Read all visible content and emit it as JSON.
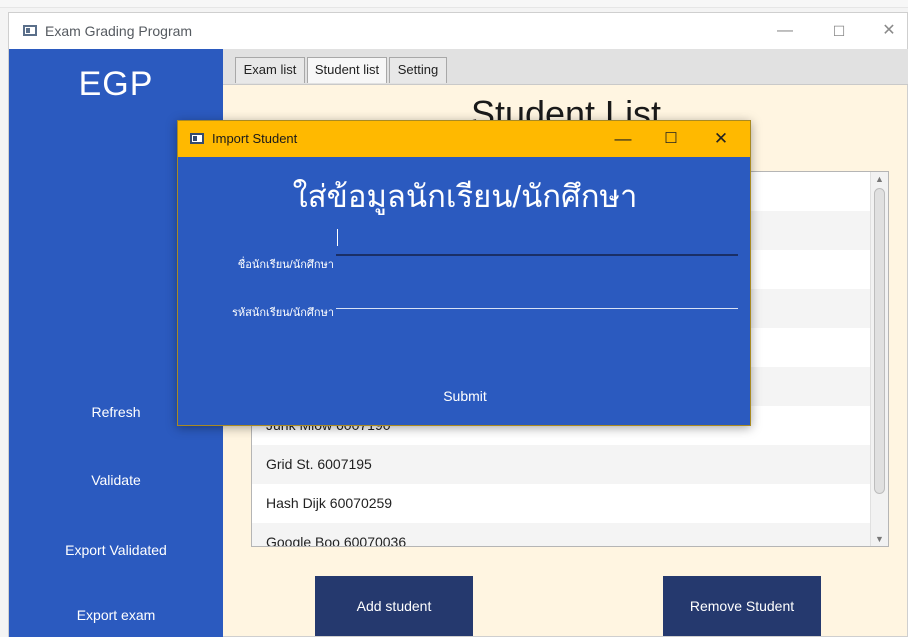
{
  "window": {
    "title": "Exam Grading Program",
    "controls": {
      "minimize": "—",
      "maximize": "☐",
      "close": "✕"
    }
  },
  "sidebar": {
    "brand": "EGP",
    "buttons": [
      "Refresh",
      "Validate",
      "Export Validated",
      "Export exam"
    ]
  },
  "tabs": [
    {
      "label": "Exam list",
      "active": false
    },
    {
      "label": "Student list",
      "active": true
    },
    {
      "label": "Setting",
      "active": false
    }
  ],
  "main": {
    "title": "Student List",
    "students": [
      {
        "text": ""
      },
      {
        "text": ""
      },
      {
        "text": ""
      },
      {
        "text": ""
      },
      {
        "text": ""
      },
      {
        "text": ""
      },
      {
        "text": "Junk Mlow 6007190"
      },
      {
        "text": "Grid St. 6007195"
      },
      {
        "text": "Hash Dijk 60070259"
      },
      {
        "text": "Google Boo 60070036"
      }
    ],
    "add_button": "Add student",
    "remove_button": "Remove Student"
  },
  "dialog": {
    "title": "Import Student",
    "controls": {
      "minimize": "—",
      "maximize": "☐",
      "close": "✕"
    },
    "heading": "ใส่ข้อมูลนักเรียน/นักศึกษา",
    "name_label": "ชื่อนักเรียน/นักศึกษา",
    "name_value": "",
    "id_label": "รหัสนักเรียน/นักศึกษา",
    "id_value": "",
    "submit": "Submit"
  },
  "colors": {
    "sidebar": "#2b5abf",
    "content_bg": "#fff5e1",
    "dialog_titlebar": "#ffb900",
    "action_button": "#25396e"
  }
}
